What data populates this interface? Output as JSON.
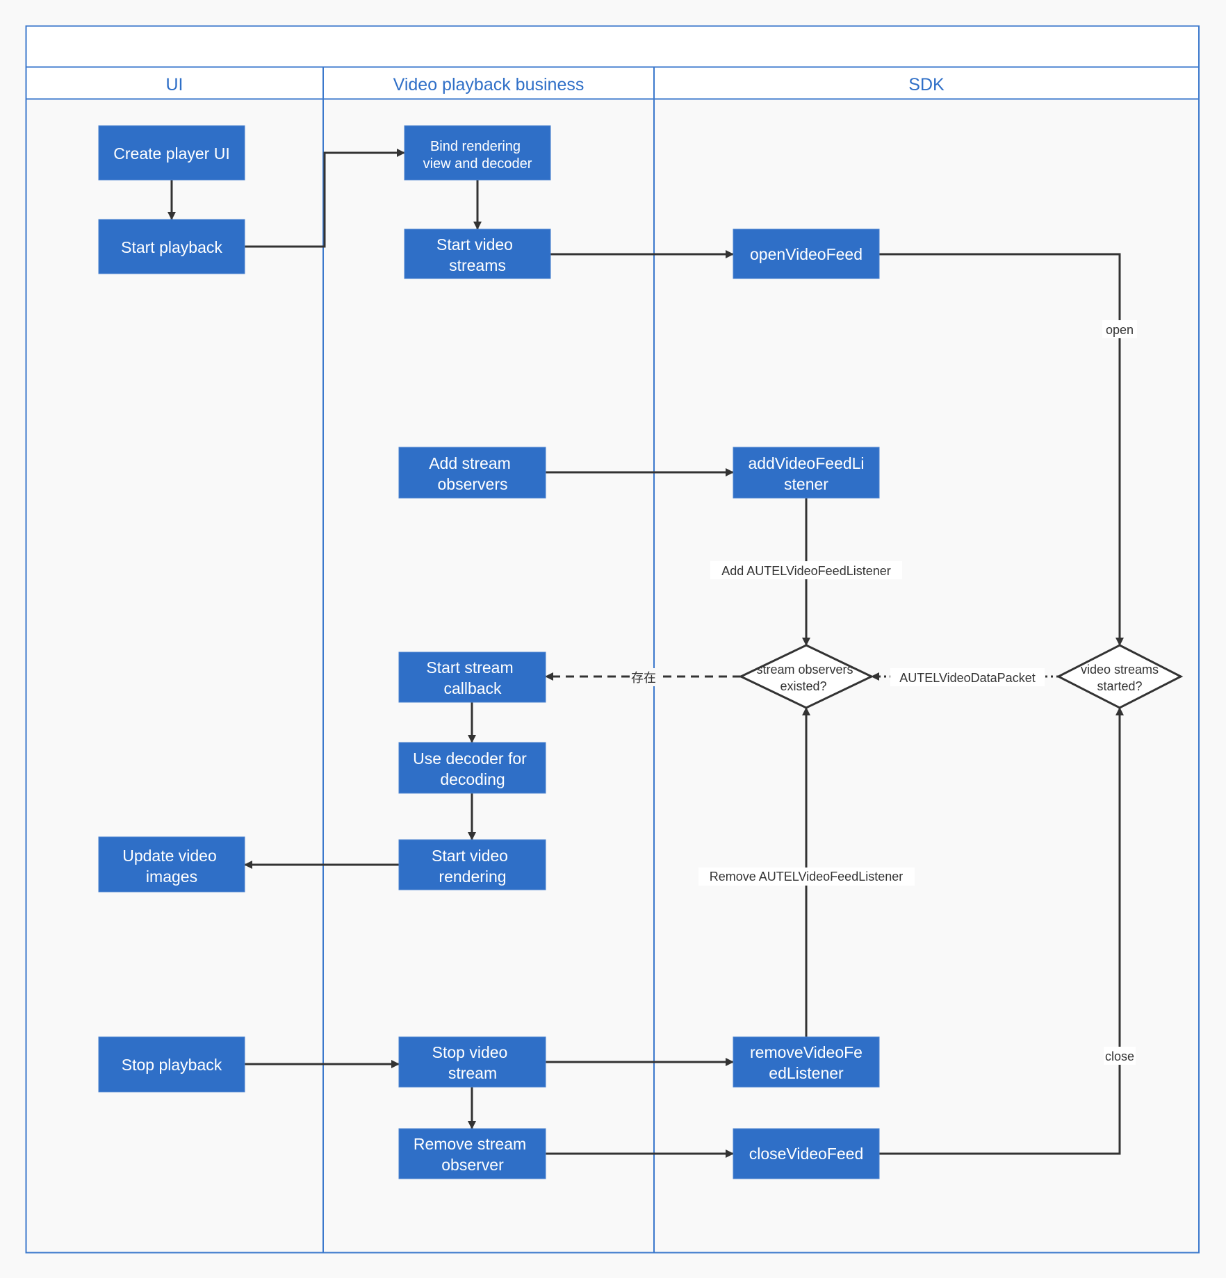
{
  "diagram": {
    "title": "",
    "lanes": [
      {
        "id": "ui",
        "label": "UI"
      },
      {
        "id": "business",
        "label": "Video playback business"
      },
      {
        "id": "sdk",
        "label": "SDK"
      }
    ],
    "nodes": [
      {
        "id": "create-player-ui",
        "lane": "ui",
        "shape": "rect",
        "lines": [
          "Create player UI"
        ]
      },
      {
        "id": "start-playback",
        "lane": "ui",
        "shape": "rect",
        "lines": [
          "Start playback"
        ]
      },
      {
        "id": "update-video-images",
        "lane": "ui",
        "shape": "rect",
        "lines": [
          "Update video",
          "images"
        ]
      },
      {
        "id": "stop-playback",
        "lane": "ui",
        "shape": "rect",
        "lines": [
          "Stop playback"
        ]
      },
      {
        "id": "bind-rendering",
        "lane": "business",
        "shape": "rect",
        "lines": [
          "Bind rendering",
          "view and decoder"
        ]
      },
      {
        "id": "start-video-streams",
        "lane": "business",
        "shape": "rect",
        "lines": [
          "Start video",
          "streams"
        ]
      },
      {
        "id": "add-stream-observers",
        "lane": "business",
        "shape": "rect",
        "lines": [
          "Add stream",
          "observers"
        ]
      },
      {
        "id": "start-stream-callback",
        "lane": "business",
        "shape": "rect",
        "lines": [
          "Start stream",
          "callback"
        ]
      },
      {
        "id": "use-decoder",
        "lane": "business",
        "shape": "rect",
        "lines": [
          "Use decoder for",
          "decoding"
        ]
      },
      {
        "id": "start-video-rendering",
        "lane": "business",
        "shape": "rect",
        "lines": [
          "Start video",
          "rendering"
        ]
      },
      {
        "id": "stop-video-stream",
        "lane": "business",
        "shape": "rect",
        "lines": [
          "Stop video",
          "stream"
        ]
      },
      {
        "id": "remove-stream-observer",
        "lane": "business",
        "shape": "rect",
        "lines": [
          "Remove stream",
          "observer"
        ]
      },
      {
        "id": "open-video-feed",
        "lane": "sdk",
        "shape": "rect",
        "lines": [
          "openVideoFeed"
        ]
      },
      {
        "id": "add-video-feed-listener",
        "lane": "sdk",
        "shape": "rect",
        "lines": [
          "addVideoFeedLi",
          "stener"
        ]
      },
      {
        "id": "remove-video-feed-listener",
        "lane": "sdk",
        "shape": "rect",
        "lines": [
          "removeVideoFe",
          "edListener"
        ]
      },
      {
        "id": "close-video-feed",
        "lane": "sdk",
        "shape": "rect",
        "lines": [
          "closeVideoFeed"
        ]
      },
      {
        "id": "stream-observers-existed",
        "lane": "sdk",
        "shape": "diamond",
        "lines": [
          "stream observers",
          "existed?"
        ]
      },
      {
        "id": "video-streams-started",
        "lane": "sdk",
        "shape": "diamond",
        "lines": [
          "video streams",
          "started?"
        ]
      }
    ],
    "edges": [
      {
        "from": "create-player-ui",
        "to": "start-playback",
        "label": "",
        "style": "solid"
      },
      {
        "from": "start-playback",
        "to": "bind-rendering",
        "label": "",
        "style": "solid"
      },
      {
        "from": "bind-rendering",
        "to": "start-video-streams",
        "label": "",
        "style": "solid"
      },
      {
        "from": "start-video-streams",
        "to": "open-video-feed",
        "label": "",
        "style": "solid"
      },
      {
        "from": "open-video-feed",
        "to": "video-streams-started",
        "label": "open",
        "style": "solid"
      },
      {
        "from": "add-stream-observers",
        "to": "add-video-feed-listener",
        "label": "",
        "style": "solid"
      },
      {
        "from": "add-video-feed-listener",
        "to": "stream-observers-existed",
        "label": "Add AUTELVideoFeedListener",
        "style": "solid"
      },
      {
        "from": "video-streams-started",
        "to": "stream-observers-existed",
        "label": "AUTELVideoDataPacket",
        "style": "dotted"
      },
      {
        "from": "stream-observers-existed",
        "to": "start-stream-callback",
        "label": "存在",
        "style": "dashed"
      },
      {
        "from": "start-stream-callback",
        "to": "use-decoder",
        "label": "",
        "style": "solid"
      },
      {
        "from": "use-decoder",
        "to": "start-video-rendering",
        "label": "",
        "style": "solid"
      },
      {
        "from": "start-video-rendering",
        "to": "update-video-images",
        "label": "",
        "style": "solid"
      },
      {
        "from": "stop-playback",
        "to": "stop-video-stream",
        "label": "",
        "style": "solid"
      },
      {
        "from": "stop-video-stream",
        "to": "remove-stream-observer",
        "label": "",
        "style": "solid"
      },
      {
        "from": "stop-video-stream",
        "to": "remove-video-feed-listener",
        "label": "",
        "style": "solid"
      },
      {
        "from": "remove-video-feed-listener",
        "to": "stream-observers-existed",
        "label": "Remove AUTELVideoFeedListener",
        "style": "solid"
      },
      {
        "from": "remove-stream-observer",
        "to": "close-video-feed",
        "label": "",
        "style": "solid"
      },
      {
        "from": "close-video-feed",
        "to": "video-streams-started",
        "label": "close",
        "style": "solid"
      }
    ]
  },
  "colors": {
    "node_fill": "#2f6fc7",
    "node_text": "#ffffff",
    "lane_border": "#3b78cc",
    "lane_title": "#2f6fc7",
    "edge": "#333333",
    "background": "#f9f9f9",
    "header_fill": "#ffffff"
  }
}
